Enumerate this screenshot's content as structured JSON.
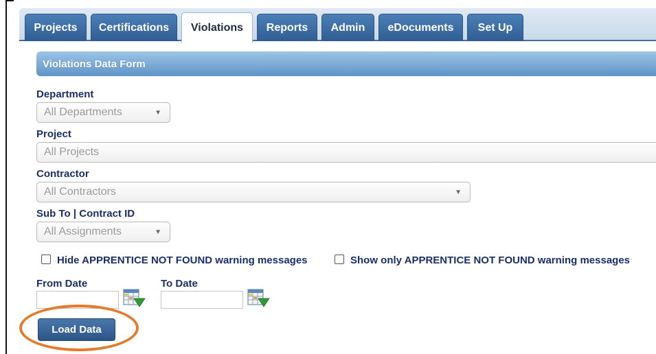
{
  "tabs": [
    {
      "label": "Projects"
    },
    {
      "label": "Certifications"
    },
    {
      "label": "Violations"
    },
    {
      "label": "Reports"
    },
    {
      "label": "Admin"
    },
    {
      "label": "eDocuments"
    },
    {
      "label": "Set Up"
    }
  ],
  "active_tab": "Violations",
  "form": {
    "title": "Violations Data Form",
    "department": {
      "label": "Department",
      "value": "All Departments"
    },
    "project": {
      "label": "Project",
      "value": "All Projects"
    },
    "contractor": {
      "label": "Contractor",
      "value": "All Contractors"
    },
    "subto": {
      "label": "Sub To | Contract ID",
      "value": "All Assignments"
    },
    "checkbox_hide": {
      "label": "Hide APPRENTICE NOT FOUND warning messages",
      "checked": false
    },
    "checkbox_show_only": {
      "label": "Show only APPRENTICE NOT FOUND warning messages",
      "checked": false
    },
    "from_date": {
      "label": "From Date",
      "value": ""
    },
    "to_date": {
      "label": "To Date",
      "value": ""
    },
    "load_button": "Load Data"
  },
  "colors": {
    "tab_blue": "#3a6ca3",
    "header_blue": "#6fa0d0",
    "label_navy": "#1a2e6b",
    "highlight_orange": "#e47a2a"
  }
}
